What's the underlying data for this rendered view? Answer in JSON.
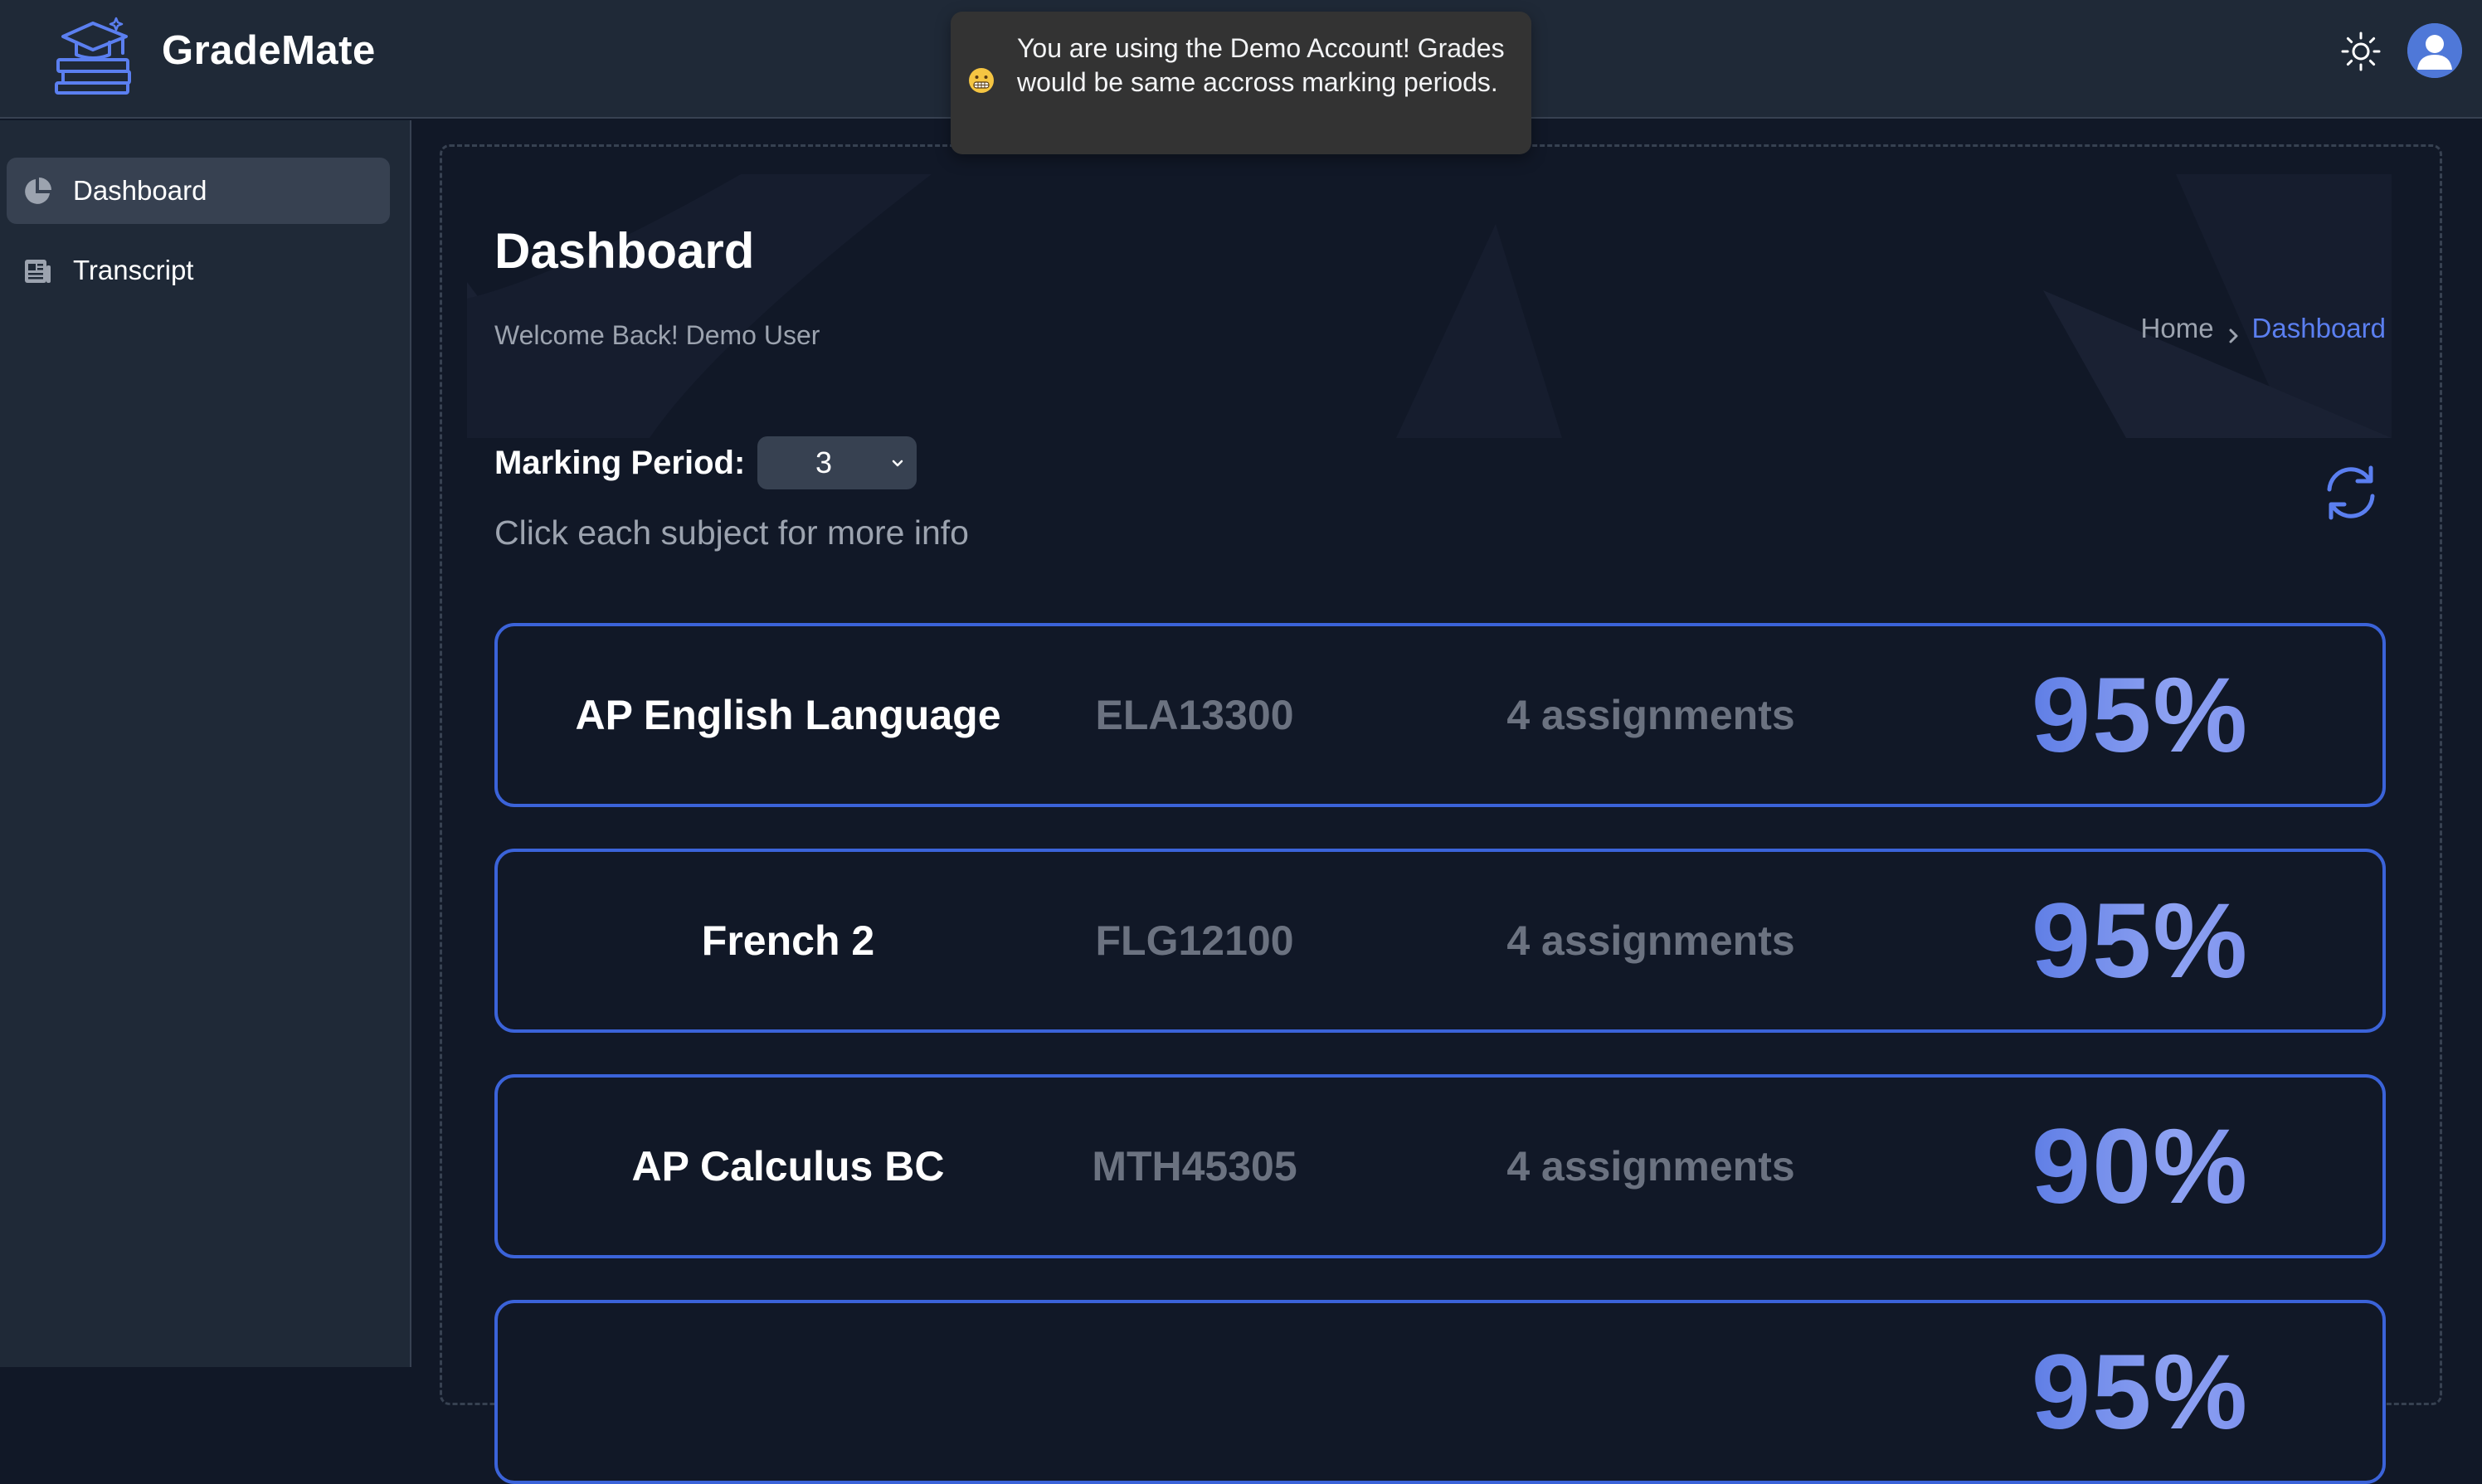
{
  "app": {
    "name": "GradeMate"
  },
  "toast": {
    "message": "You are using the Demo Account! Grades would be same accross marking periods.",
    "emoji": "grimacing-face-icon"
  },
  "sidebar": {
    "items": [
      {
        "label": "Dashboard",
        "icon": "pie-chart-icon",
        "active": true
      },
      {
        "label": "Transcript",
        "icon": "newspaper-icon",
        "active": false
      }
    ]
  },
  "page": {
    "title": "Dashboard",
    "welcome": "Welcome Back! Demo User",
    "breadcrumb": {
      "home": "Home",
      "current": "Dashboard"
    }
  },
  "marking_period": {
    "label": "Marking Period:",
    "selected": "3"
  },
  "hint": "Click each subject for more info",
  "subjects": [
    {
      "name": "AP English Language",
      "code": "ELA13300",
      "assignments": "4 assignments",
      "grade": "95%"
    },
    {
      "name": "French 2",
      "code": "FLG12100",
      "assignments": "4 assignments",
      "grade": "95%"
    },
    {
      "name": "AP Calculus BC",
      "code": "MTH45305",
      "assignments": "4 assignments",
      "grade": "90%"
    },
    {
      "name": "",
      "code": "",
      "assignments": "",
      "grade": "95%"
    }
  ],
  "colors": {
    "accent": "#3b63d9",
    "link": "#5b7ff0",
    "background": "#111827",
    "panel": "#1f2937"
  }
}
